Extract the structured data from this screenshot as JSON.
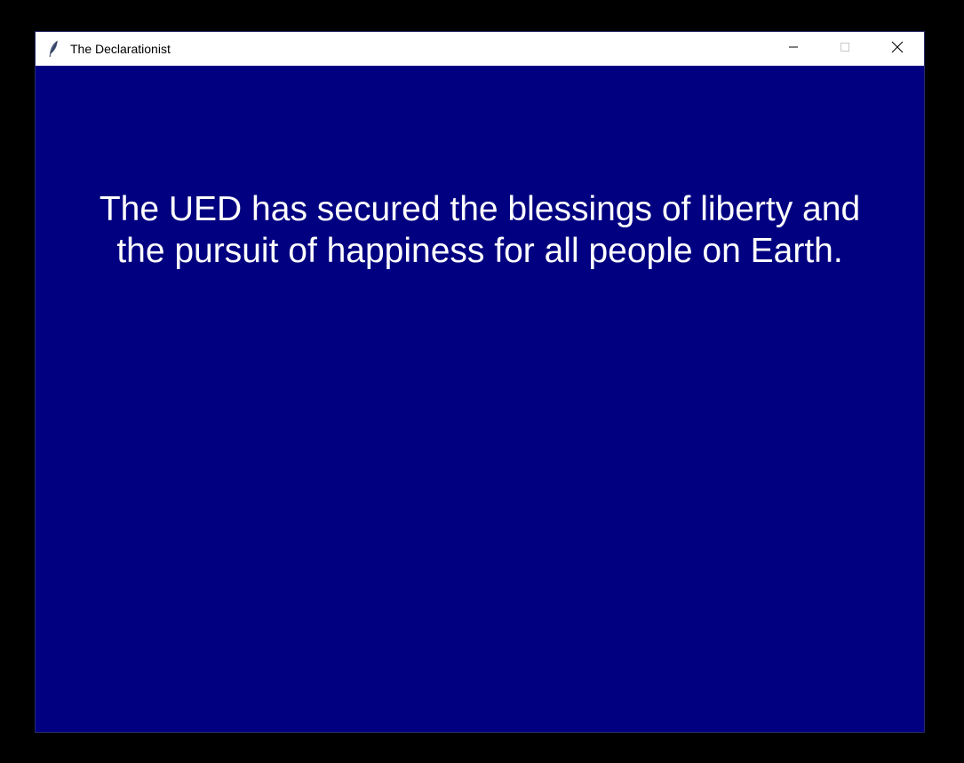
{
  "window": {
    "title": "The Declarationist",
    "icon": "feather-icon",
    "controls": {
      "minimize_icon": "minimize-icon",
      "maximize_icon": "maximize-icon",
      "close_icon": "close-icon"
    }
  },
  "content": {
    "message": "The UED has secured the blessings of liberty and the pursuit of happiness for all people on Earth."
  },
  "colors": {
    "background": "#000080",
    "text": "#ffffff",
    "titlebar": "#ffffff",
    "desktop": "#000000"
  }
}
